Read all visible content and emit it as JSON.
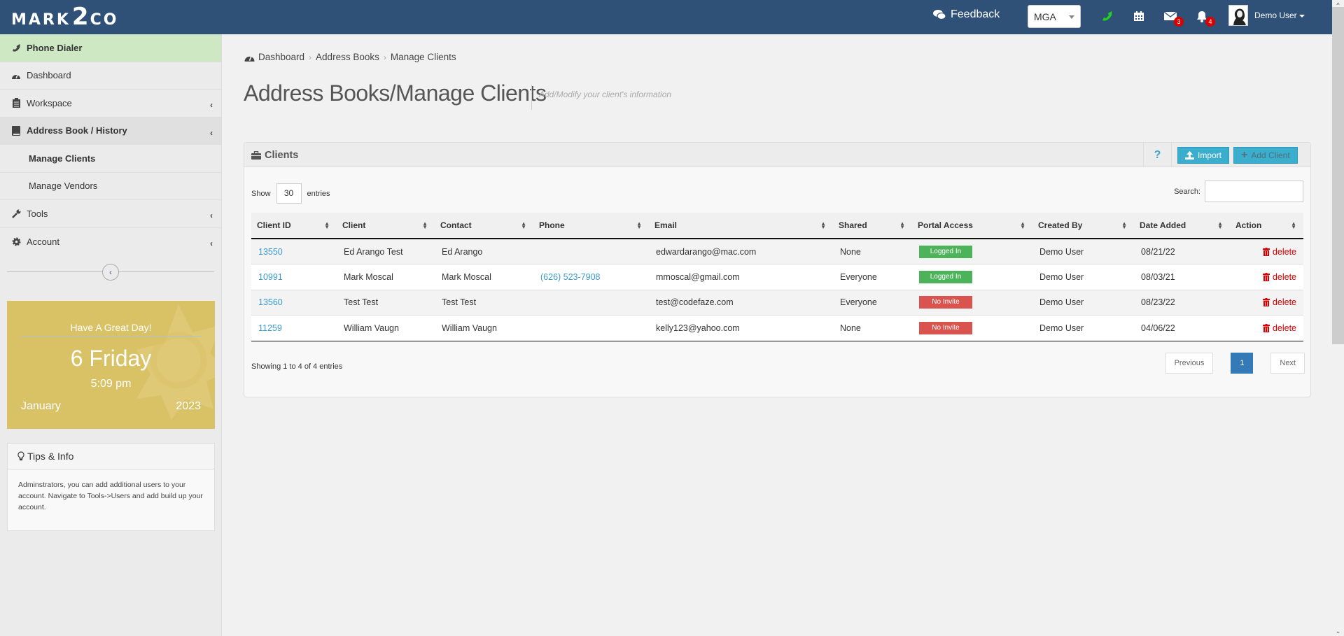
{
  "header": {
    "logo": {
      "left": "MARK",
      "mid": "2",
      "right": "CO"
    },
    "feedback_label": "Feedback",
    "org_select": "MGA",
    "mail_count": "3",
    "notification_count": "4",
    "user_name": "Demo User"
  },
  "sidebar": {
    "items": [
      {
        "label": "Phone Dialer"
      },
      {
        "label": "Dashboard"
      },
      {
        "label": "Workspace"
      },
      {
        "label": "Address Book / History"
      },
      {
        "label": "Manage Clients"
      },
      {
        "label": "Manage Vendors"
      },
      {
        "label": "Tools"
      },
      {
        "label": "Account"
      }
    ],
    "day_card": {
      "greeting": "Have A Great Day!",
      "day": "6 Friday",
      "time": "5:09 pm",
      "month": "January",
      "year": "2023"
    },
    "tips": {
      "title": "Tips & Info",
      "body": "Adminstrators, you can add additional users to your account. Navigate to Tools->Users and add build up your account."
    }
  },
  "breadcrumb": [
    "Dashboard",
    "Address Books",
    "Manage Clients"
  ],
  "page": {
    "title": "Address Books/Manage Clients",
    "subtitle": "Add/Modify your client's information"
  },
  "panel": {
    "title": "Clients",
    "help_label": "?",
    "import_label": "Import",
    "add_label": "Add Client",
    "show_label": "Show",
    "entries_value": "30",
    "entries_label": "entries",
    "search_label": "Search:",
    "search_value": "",
    "info": "Showing 1 to 4 of 4 entries",
    "prev_label": "Previous",
    "page": "1",
    "next_label": "Next"
  },
  "table": {
    "columns": [
      "Client ID",
      "Client",
      "Contact",
      "Phone",
      "Email",
      "Shared",
      "Portal Access",
      "Created By",
      "Date Added",
      "Action"
    ],
    "rows": [
      {
        "id": "13550",
        "client": "Ed Arango Test",
        "contact": "Ed Arango",
        "phone": "",
        "email": "edwardarango@mac.com",
        "shared": "None",
        "portal": "Logged In",
        "created_by": "Demo User",
        "date": "08/21/22",
        "action": "delete"
      },
      {
        "id": "10991",
        "client": "Mark Moscal",
        "contact": "Mark Moscal",
        "phone": "(626) 523-7908",
        "email": "mmoscal@gmail.com",
        "shared": "Everyone",
        "portal": "Logged In",
        "created_by": "Demo User",
        "date": "08/03/21",
        "action": "delete"
      },
      {
        "id": "13560",
        "client": "Test Test",
        "contact": "Test Test",
        "phone": "",
        "email": "test@codefaze.com",
        "shared": "Everyone",
        "portal": "No Invite",
        "created_by": "Demo User",
        "date": "08/23/22",
        "action": "delete"
      },
      {
        "id": "11259",
        "client": "William Vaugn",
        "contact": "William Vaugn",
        "phone": "",
        "email": "kelly123@yahoo.com",
        "shared": "None",
        "portal": "No Invite",
        "created_by": "Demo User",
        "date": "04/06/22",
        "action": "delete"
      }
    ]
  },
  "colors": {
    "topbar": "#2f5178",
    "phone_dialer_bg": "#cde8c3",
    "day_card": "#d9c166",
    "info_button": "#3aaecc",
    "logged_in": "#4db35b",
    "no_invite": "#d9534f",
    "link": "#3a9ad0",
    "delete": "#d80000",
    "pager_active": "#337ab7"
  }
}
